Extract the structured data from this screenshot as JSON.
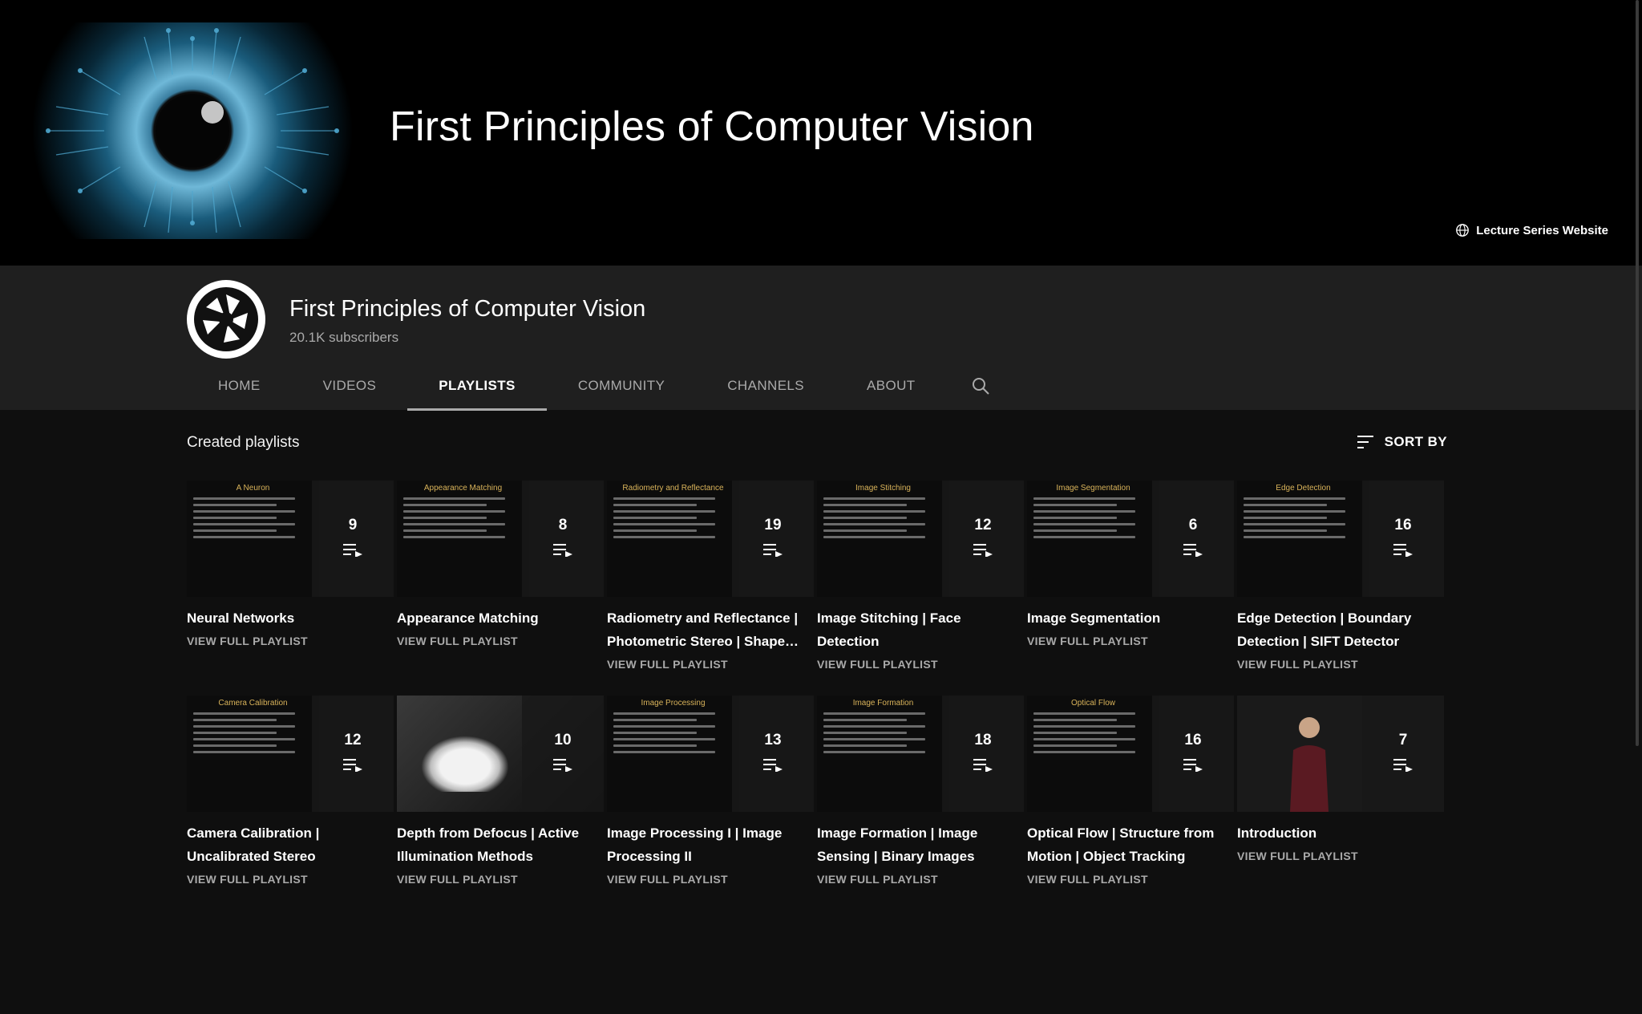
{
  "banner": {
    "title": "First Principles of Computer Vision",
    "link_label": "Lecture Series Website"
  },
  "channel": {
    "name": "First Principles of Computer Vision",
    "subscribers": "20.1K subscribers"
  },
  "tabs": [
    {
      "label": "HOME",
      "active": false
    },
    {
      "label": "VIDEOS",
      "active": false
    },
    {
      "label": "PLAYLISTS",
      "active": true
    },
    {
      "label": "COMMUNITY",
      "active": false
    },
    {
      "label": "CHANNELS",
      "active": false
    },
    {
      "label": "ABOUT",
      "active": false
    }
  ],
  "section": {
    "title": "Created playlists",
    "sort_label": "SORT BY"
  },
  "view_full_label": "VIEW FULL PLAYLIST",
  "playlists": [
    {
      "title": "Neural Networks",
      "count": "9",
      "slide": "A Neuron"
    },
    {
      "title": "Appearance Matching",
      "count": "8",
      "slide": "Appearance Matching"
    },
    {
      "title": "Radiometry and Reflectance | Photometric Stereo | Shape…",
      "count": "19",
      "slide": "Radiometry and Reflectance"
    },
    {
      "title": "Image Stitching | Face Detection",
      "count": "12",
      "slide": "Image Stitching"
    },
    {
      "title": "Image Segmentation",
      "count": "6",
      "slide": "Image Segmentation"
    },
    {
      "title": "Edge Detection | Boundary Detection | SIFT Detector",
      "count": "16",
      "slide": "Edge Detection"
    },
    {
      "title": "Camera Calibration | Uncalibrated Stereo",
      "count": "12",
      "slide": "Camera Calibration"
    },
    {
      "title": "Depth from Defocus | Active Illumination Methods",
      "count": "10",
      "slide": ""
    },
    {
      "title": "Image Processing I | Image Processing II",
      "count": "13",
      "slide": "Image Processing"
    },
    {
      "title": "Image Formation | Image Sensing | Binary Images",
      "count": "18",
      "slide": "Image Formation"
    },
    {
      "title": "Optical Flow | Structure from Motion | Object Tracking",
      "count": "16",
      "slide": "Optical Flow"
    },
    {
      "title": "Introduction",
      "count": "7",
      "slide": ""
    }
  ],
  "colors": {
    "background": "#0f0f0f",
    "header": "#1f1f1f",
    "banner": "#000000",
    "accent_slide_title": "#d9b35a",
    "muted_text": "#aaaaaa"
  },
  "icons": {
    "banner_link": "globe-icon",
    "search": "search-icon",
    "sort": "sort-icon",
    "playlist": "playlist-play-icon",
    "avatar": "aperture-icon"
  }
}
